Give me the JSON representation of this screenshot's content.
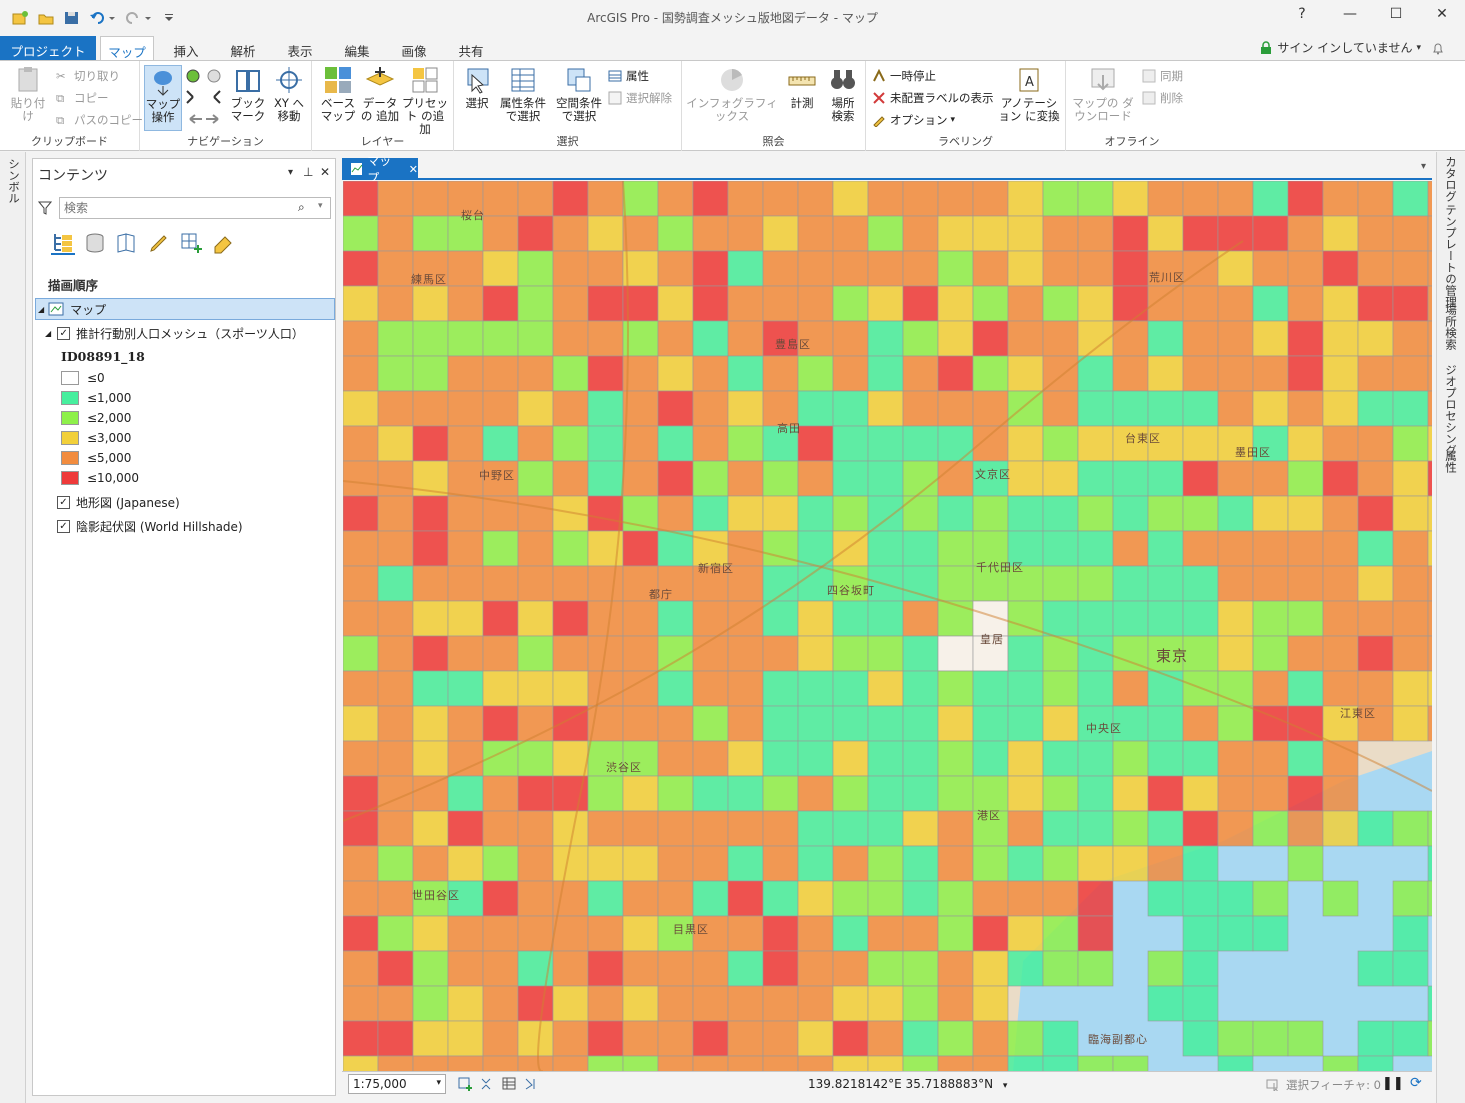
{
  "window": {
    "title": "ArcGIS Pro - 国勢調査メッシュ版地図データ - マップ",
    "help": "?",
    "min": "—",
    "max": "☐",
    "close": "✕"
  },
  "tabs": [
    "プロジェクト",
    "マップ",
    "挿入",
    "解析",
    "表示",
    "編集",
    "画像",
    "共有"
  ],
  "signin": "サイン インしていません",
  "ribbon": {
    "clipboard": {
      "label": "クリップボード",
      "paste": "貼り付け",
      "cut": "切り取り",
      "copy": "コピー",
      "copy_path": "パスのコピー"
    },
    "navigation": {
      "label": "ナビゲーション",
      "explore": "マップ操作",
      "bookmarks": "ブック マーク",
      "goto_xy": "XY へ移動"
    },
    "layer": {
      "label": "レイヤー",
      "basemap": "ベース マップ",
      "add_data": "データの 追加",
      "add_preset": "プリセット の追加"
    },
    "selection": {
      "label": "選択",
      "select": "選択",
      "by_attr": "属性条件 で選択",
      "by_loc": "空間条件 で選択",
      "attributes": "属性",
      "clear": "選択解除"
    },
    "inquiry": {
      "label": "照会",
      "infographics": "インフォグラフィックス",
      "measure": "計測",
      "locate": "場所 検索"
    },
    "labeling": {
      "label": "ラベリング",
      "pause": "一時停止",
      "unplaced": "未配置ラベルの表示",
      "options": "オプション",
      "convert": "アノテーション に変換"
    },
    "offline": {
      "label": "オフライン",
      "download": "マップの ダウンロード",
      "sync": "同期",
      "remove": "削除"
    }
  },
  "left_strip": "シンボル",
  "right_strip": [
    "カタログ",
    "テンプレートの管理",
    "場所検索",
    "ジオプロセシング",
    "属性"
  ],
  "contents": {
    "title": "コンテンツ",
    "search_placeholder": "検索",
    "draw_order": "描画順序",
    "map_item": "マップ",
    "layer_name": "推計行動別人口メッシュ（スポーツ人口）",
    "field_name": "ID08891_18",
    "legend": [
      {
        "label": "≤0",
        "color": "#ffffff"
      },
      {
        "label": "≤1,000",
        "color": "#47ef9e"
      },
      {
        "label": "≤2,000",
        "color": "#8ef04a"
      },
      {
        "label": "≤3,000",
        "color": "#f2d03a"
      },
      {
        "label": "≤5,000",
        "color": "#f28c3e"
      },
      {
        "label": "≤10,000",
        "color": "#ee3a3a"
      }
    ],
    "topo_layer": "地形図 (Japanese)",
    "hillshade_layer": "陰影起伏図 (World Hillshade)"
  },
  "map_view": {
    "tab_label": "マップ",
    "place_labels": [
      {
        "text": "桜台"
      },
      {
        "text": "練馬区"
      },
      {
        "text": "荒川区"
      },
      {
        "text": "豊島区"
      },
      {
        "text": "高田"
      },
      {
        "text": "台東区"
      },
      {
        "text": "墨田区"
      },
      {
        "text": "中野区"
      },
      {
        "text": "文京区"
      },
      {
        "text": "新宿区"
      },
      {
        "text": "千代田区"
      },
      {
        "text": "都庁"
      },
      {
        "text": "四谷坂町"
      },
      {
        "text": "皇居"
      },
      {
        "text": "東京"
      },
      {
        "text": "江東区"
      },
      {
        "text": "中央区"
      },
      {
        "text": "渋谷区"
      },
      {
        "text": "港区"
      },
      {
        "text": "世田谷区"
      },
      {
        "text": "目黒区"
      },
      {
        "text": "臨海副都心"
      }
    ]
  },
  "status": {
    "scale": "1:75,000",
    "coordinates": "139.8218142°E 35.7188883°N",
    "selected_features": "選択フィーチャ: 0"
  }
}
